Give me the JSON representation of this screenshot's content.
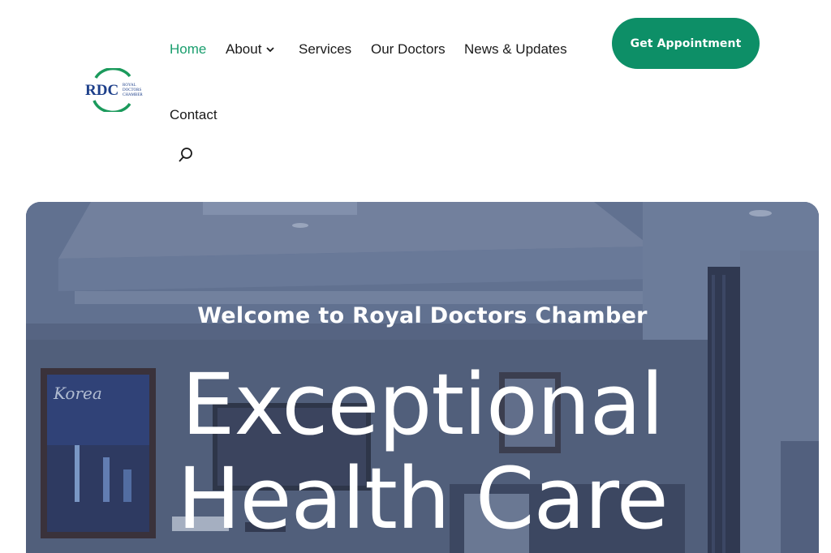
{
  "brand": {
    "logo_text": "RDC",
    "logo_tagline_1": "ROYAL",
    "logo_tagline_2": "DOCTORS",
    "logo_tagline_3": "CHAMBER"
  },
  "nav": {
    "items": [
      {
        "label": "Home",
        "active": true
      },
      {
        "label": "About",
        "has_dropdown": true
      },
      {
        "label": "Services"
      },
      {
        "label": "Our Doctors"
      },
      {
        "label": "News & Updates"
      },
      {
        "label": "Contact"
      }
    ],
    "search_icon": "search-icon"
  },
  "cta": {
    "label": "Get Appointment"
  },
  "hero": {
    "subtitle": "Welcome to Royal Doctors Chamber",
    "title_line1": "Exceptional",
    "title_line2": "Health Care",
    "poster_text": "Korea"
  },
  "colors": {
    "accent": "#0d8f67",
    "active_nav": "#1a9e6e",
    "hero_overlay": "#4f5f7e"
  }
}
